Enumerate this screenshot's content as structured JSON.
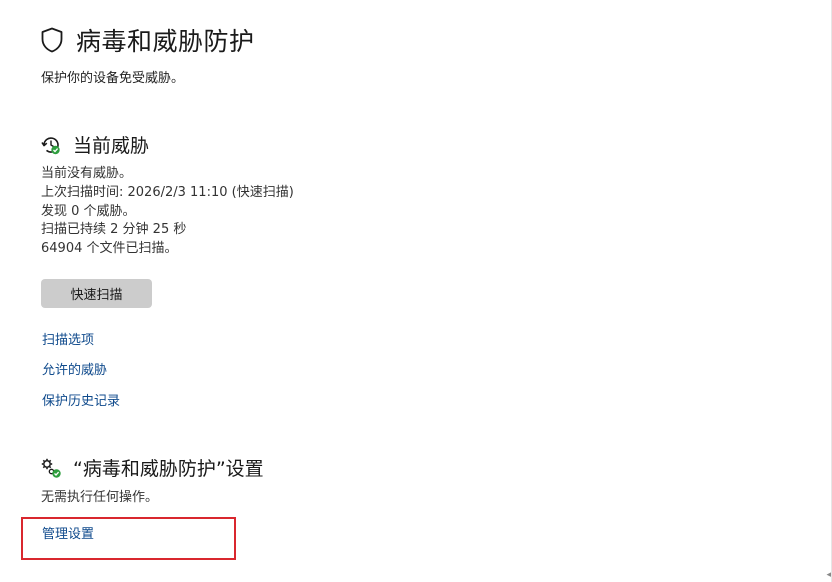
{
  "page": {
    "title": "病毒和威胁防护",
    "subtitle": "保护你的设备免受威胁。",
    "icon": "shield-icon"
  },
  "current_threats": {
    "title": "当前威胁",
    "icon": "refresh-check-icon",
    "lines": [
      "当前没有威胁。",
      "上次扫描时间: 2026/2/3 11:10 (快速扫描)",
      "发现 0 个威胁。",
      "扫描已持续 2 分钟 25 秒",
      "64904 个文件已扫描。"
    ],
    "quick_scan_label": "快速扫描"
  },
  "links": {
    "scan_options": "扫描选项",
    "allowed_threats": "允许的威胁",
    "protection_history": "保护历史记录"
  },
  "settings": {
    "title": "“病毒和威胁防护”设置",
    "icon": "gears-check-icon",
    "status": "无需执行任何操作。",
    "manage_label": "管理设置"
  },
  "colors": {
    "link": "#0f4a8c",
    "button_bg": "#cccccc",
    "highlight": "#d9272e",
    "check_green": "#2e9e3e"
  }
}
